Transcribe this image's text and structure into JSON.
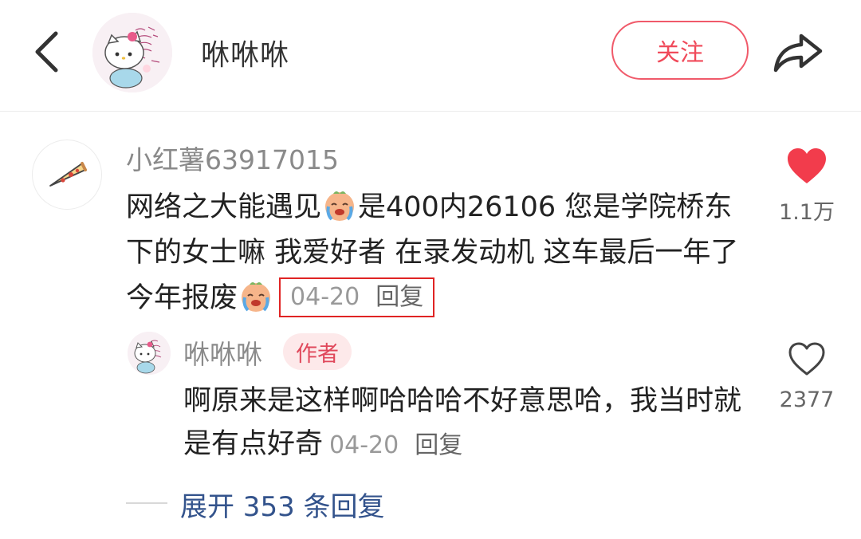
{
  "header": {
    "author_name": "咻咻咻",
    "follow_label": "关注",
    "icons": {
      "back": "chevron-left-icon",
      "share": "share-arrow-icon"
    }
  },
  "comment": {
    "username": "小红薯63917015",
    "text_part1": "网络之大能遇见",
    "text_part2": "是400内26106 您是学院桥东下的女士嘛 我爱好者 在录发动机 这车最后一年了今年报废",
    "date": "04-20",
    "reply_label": "回复",
    "likes": "1.1万",
    "liked": true,
    "emojis": [
      "crying-emoji",
      "crying-emoji"
    ]
  },
  "reply": {
    "username": "咻咻咻",
    "badge": "作者",
    "text": "啊原来是这样啊哈哈哈不好意思哈，我当时就是有点好奇",
    "date": "04-20",
    "reply_label": "回复",
    "likes": "2377",
    "liked": false
  },
  "expand": {
    "label": "展开 353 条回复"
  },
  "colors": {
    "accent": "#f04a5a",
    "heart": "#f23c4c",
    "link": "#33538c",
    "highlight_box": "#e02424"
  }
}
